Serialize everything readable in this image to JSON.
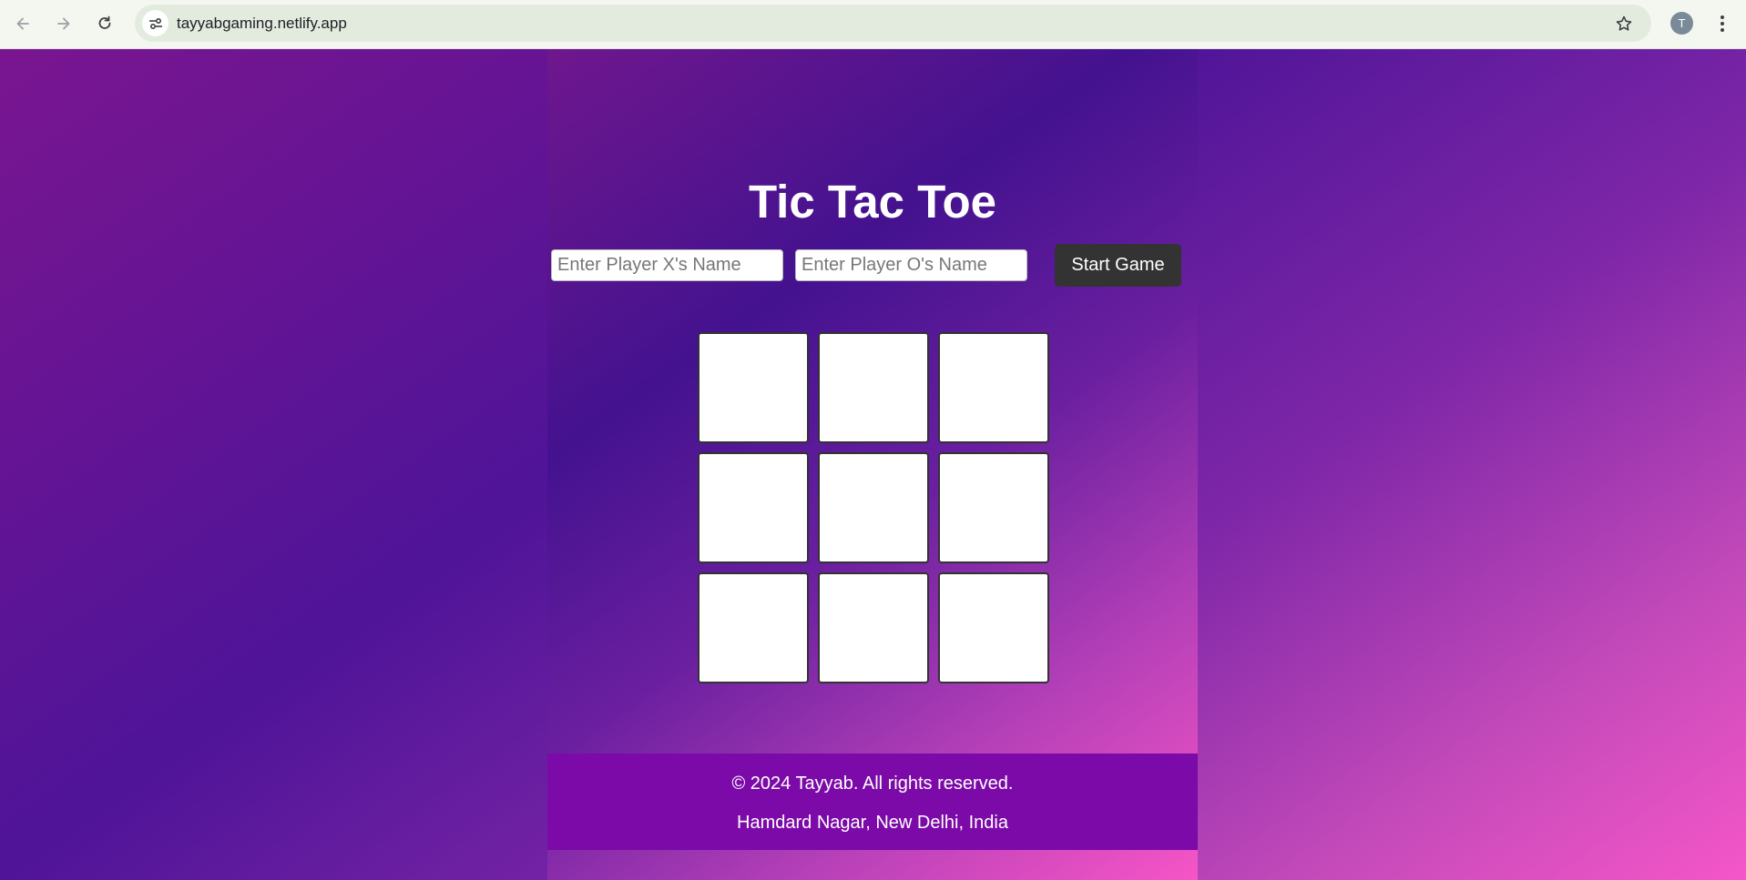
{
  "browser": {
    "url": "tayyabgaming.netlify.app",
    "avatar_initial": "T",
    "icons": {
      "back": "back-arrow-icon",
      "forward": "forward-arrow-icon",
      "reload": "reload-icon",
      "site_info": "tune-icon",
      "bookmark": "star-icon",
      "menu": "kebab-menu-icon"
    }
  },
  "game": {
    "title": "Tic Tac Toe",
    "player_x_placeholder": "Enter Player X's Name",
    "player_o_placeholder": "Enter Player O's Name",
    "player_x_value": "",
    "player_o_value": "",
    "start_label": "Start Game",
    "cells": [
      "",
      "",
      "",
      "",
      "",
      "",
      "",
      "",
      ""
    ]
  },
  "footer": {
    "copyright": "© 2024 Tayyab. All rights reserved.",
    "address": "Hamdard Nagar, New Delhi, India"
  },
  "colors": {
    "footer_bg": "#7b0aa8",
    "button_bg": "#333333",
    "gradient_start": "#7a1590",
    "gradient_end": "#f556c8"
  }
}
